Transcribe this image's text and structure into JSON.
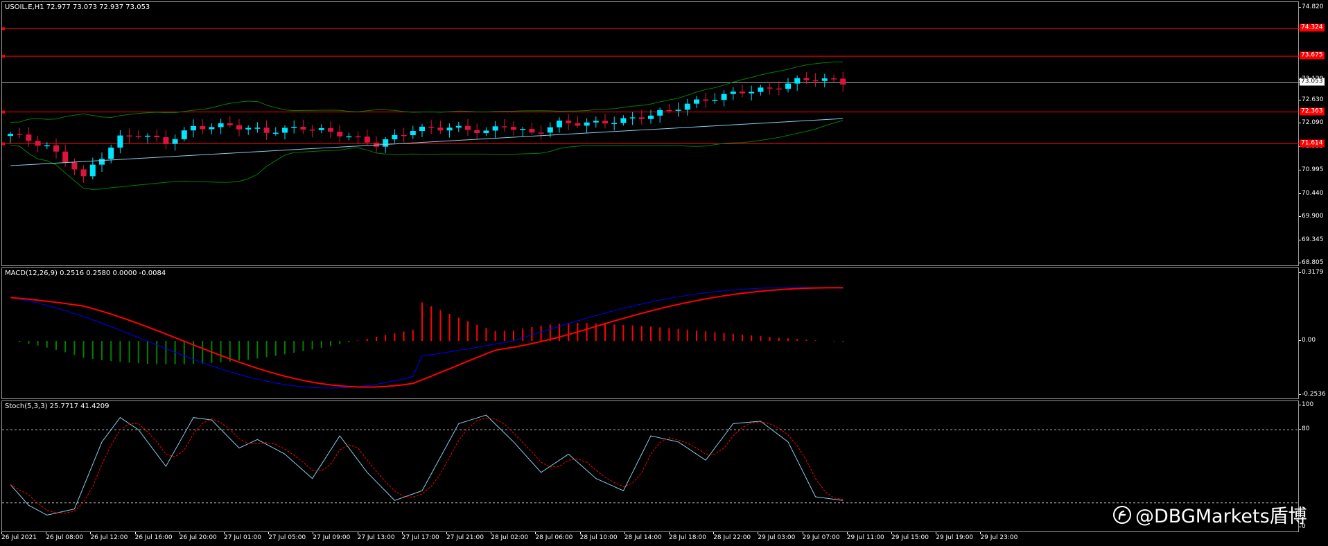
{
  "price_pane": {
    "label": "USOIL.E,H1  72.977 73.073 72.937 73.053",
    "axis_ticks": [
      "74.820",
      "73.120",
      "72.630",
      "72.090",
      "71.535",
      "70.995",
      "70.440",
      "69.900",
      "69.345",
      "68.805"
    ],
    "current_price": "73.053",
    "level_tags": [
      "74.324",
      "73.675",
      "72.363",
      "71.614"
    ]
  },
  "macd_pane": {
    "label": "MACD(12,26,9) 0.2516 0.2580 0.0000 -0.0084",
    "axis_ticks": [
      "0.3179",
      "0.00",
      "-0.2536"
    ]
  },
  "stoch_pane": {
    "label": "Stoch(5,3,3) 25.7717 41.4209",
    "axis_ticks": [
      "100",
      "80",
      "0"
    ]
  },
  "time_axis": [
    "26 Jul 2021",
    "26 Jul 08:00",
    "26 Jul 12:00",
    "26 Jul 16:00",
    "26 Jul 20:00",
    "27 Jul 01:00",
    "27 Jul 05:00",
    "27 Jul 09:00",
    "27 Jul 13:00",
    "27 Jul 17:00",
    "27 Jul 21:00",
    "28 Jul 02:00",
    "28 Jul 06:00",
    "28 Jul 10:00",
    "28 Jul 14:00",
    "28 Jul 18:00",
    "28 Jul 22:00",
    "29 Jul 03:00",
    "29 Jul 07:00",
    "29 Jul 11:00",
    "29 Jul 15:00",
    "29 Jul 19:00",
    "29 Jul 23:00"
  ],
  "watermark": "@DBGMarkets盾博",
  "colors": {
    "bull_candle": "#00e5ff",
    "bear_candle": "#dc143c",
    "level_line": "#ff0000",
    "bollinger": "#008000",
    "moving_average": "#87ceeb",
    "macd_line": "#0000ff",
    "signal_line": "#ff0000",
    "hist_positive": "#ff0000",
    "hist_negative": "#008000",
    "stoch_main": "#87ceeb",
    "stoch_signal": "#ff0000",
    "current_price_tag_bg": "#ffffff",
    "level_tag_bg": "#ff0000"
  }
}
